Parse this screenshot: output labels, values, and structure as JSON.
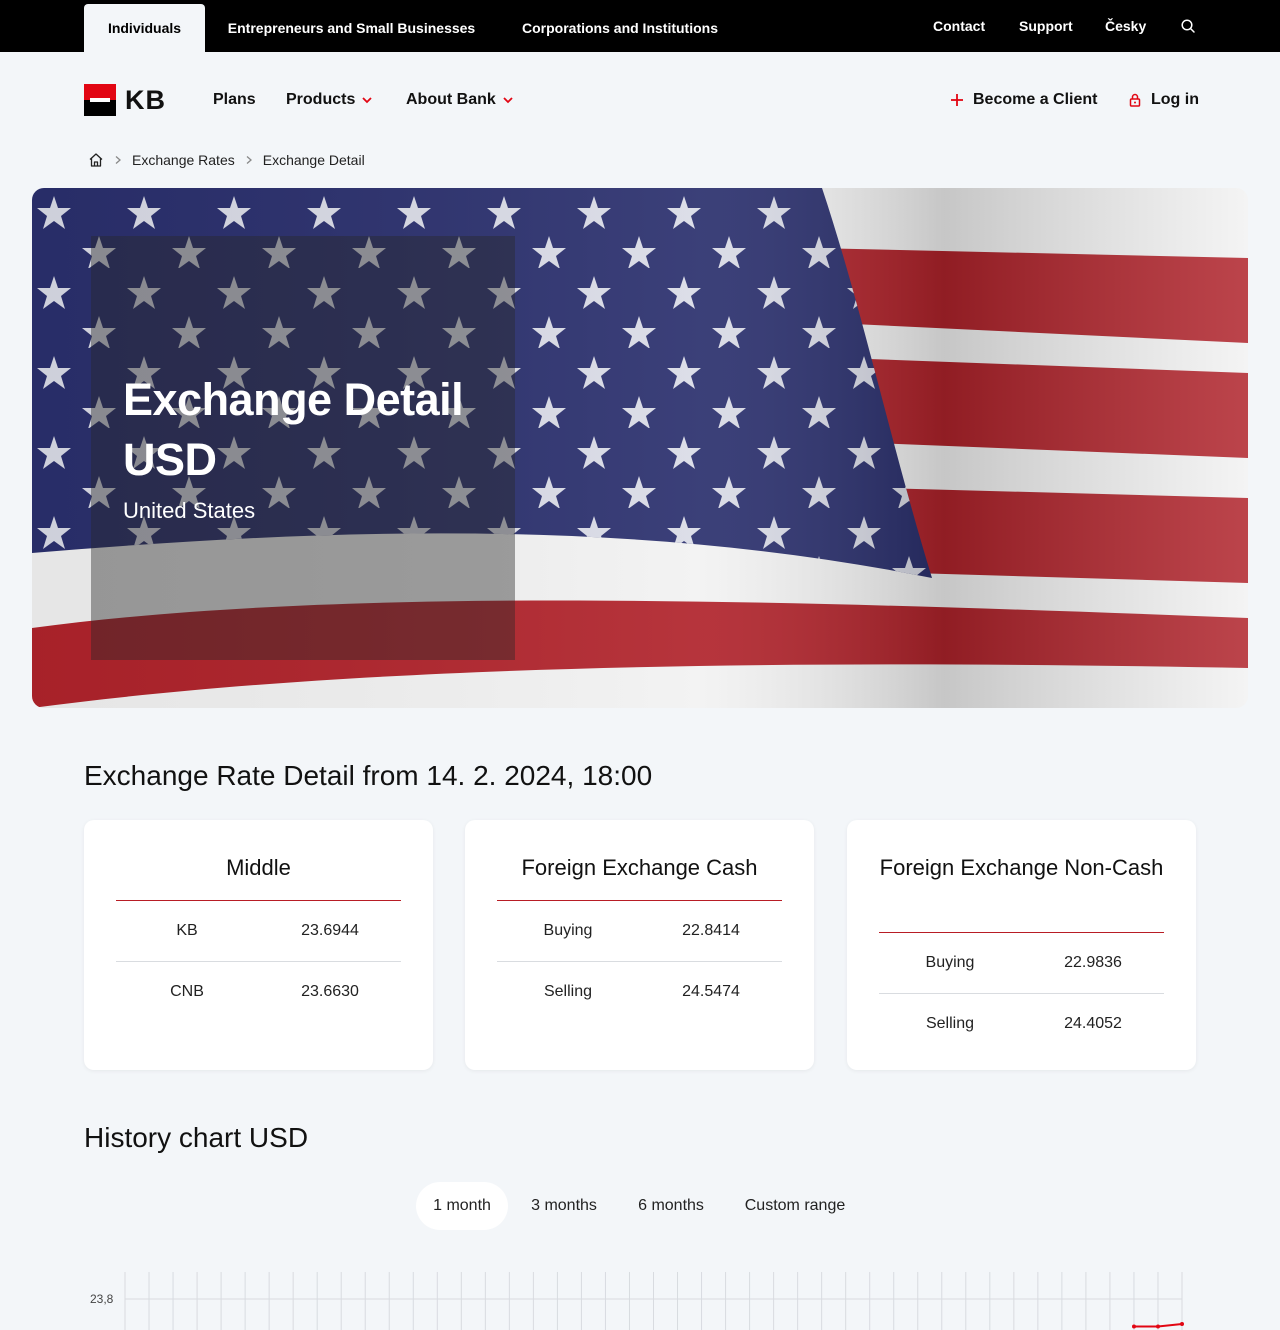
{
  "topbar": {
    "segments": [
      "Individuals",
      "Entrepreneurs and Small Businesses",
      "Corporations and Institutions"
    ],
    "links": [
      "Contact",
      "Support",
      "Česky"
    ]
  },
  "header": {
    "logo_text": "KB",
    "nav": [
      "Plans",
      "Products",
      "About Bank"
    ],
    "become_client": "Become a Client",
    "login": "Log in"
  },
  "breadcrumb": [
    "Exchange Rates",
    "Exchange Detail"
  ],
  "hero": {
    "title": "Exchange Detail USD",
    "subtitle": "United States"
  },
  "detail": {
    "heading": "Exchange Rate Detail from 14. 2. 2024, 18:00",
    "cards": [
      {
        "title": "Middle",
        "rows": [
          {
            "label": "KB",
            "value": "23.6944"
          },
          {
            "label": "CNB",
            "value": "23.6630"
          }
        ]
      },
      {
        "title": "Foreign Exchange Cash",
        "rows": [
          {
            "label": "Buying",
            "value": "22.8414"
          },
          {
            "label": "Selling",
            "value": "24.5474"
          }
        ]
      },
      {
        "title": "Foreign Exchange Non-Cash",
        "rows": [
          {
            "label": "Buying",
            "value": "22.9836"
          },
          {
            "label": "Selling",
            "value": "24.4052"
          }
        ]
      }
    ]
  },
  "history": {
    "heading": "History chart USD",
    "tabs": [
      "1 month",
      "3 months",
      "6 months",
      "Custom range"
    ],
    "active_tab": 0
  },
  "chart_data": {
    "type": "line",
    "title": "",
    "xlabel": "",
    "ylabel": "",
    "y_tick_labels": [
      "23,8"
    ],
    "series": [
      {
        "values": [
          23.69,
          23.69,
          23.7
        ]
      }
    ],
    "line_color": "#e20613",
    "grid": true
  }
}
